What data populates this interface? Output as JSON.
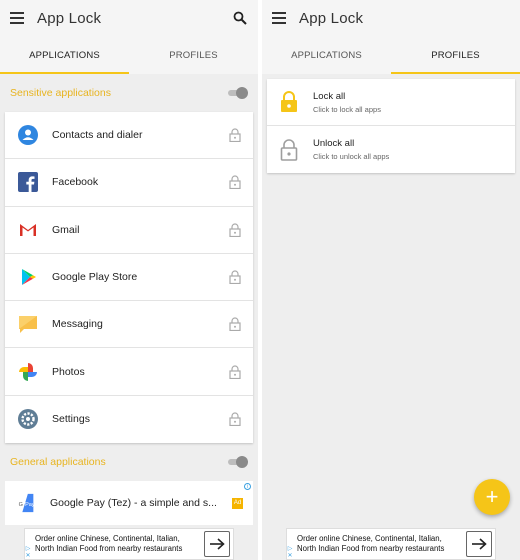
{
  "app": {
    "title": "App Lock"
  },
  "tabs": [
    {
      "label": "APPLICATIONS"
    },
    {
      "label": "PROFILES"
    }
  ],
  "left_screen": {
    "active_tab": "APPLICATIONS",
    "sensitive_section": {
      "title": "Sensitive applications",
      "toggle_on": false,
      "apps": [
        {
          "name": "Contacts and dialer",
          "icon": "contacts-icon",
          "locked": false
        },
        {
          "name": "Facebook",
          "icon": "facebook-icon",
          "locked": false
        },
        {
          "name": "Gmail",
          "icon": "gmail-icon",
          "locked": false
        },
        {
          "name": "Google Play Store",
          "icon": "play-store-icon",
          "locked": false
        },
        {
          "name": "Messaging",
          "icon": "messaging-icon",
          "locked": false
        },
        {
          "name": "Photos",
          "icon": "photos-icon",
          "locked": false
        },
        {
          "name": "Settings",
          "icon": "settings-icon",
          "locked": false
        }
      ]
    },
    "general_section": {
      "title": "General applications",
      "toggle_on": false
    },
    "ad_row": {
      "name": "Google Pay (Tez) - a simple and s...",
      "badge": "Ad",
      "icon_label": "G Pay"
    }
  },
  "right_screen": {
    "active_tab": "PROFILES",
    "profiles": [
      {
        "title": "Lock all",
        "subtitle": "Click to lock all apps",
        "icon": "lock-closed-icon",
        "color": "#f5c518"
      },
      {
        "title": "Unlock all",
        "subtitle": "Click to unlock all apps",
        "icon": "lock-open-icon",
        "color": "#9e9e9e"
      }
    ],
    "fab_label": "+"
  },
  "banner": {
    "line1": "Order online Chinese, Continental, Italian,",
    "line2": "North Indian Food from nearby restaurants",
    "arrow": "→"
  },
  "colors": {
    "accent": "#f5c518",
    "section_title": "#e8b420"
  }
}
